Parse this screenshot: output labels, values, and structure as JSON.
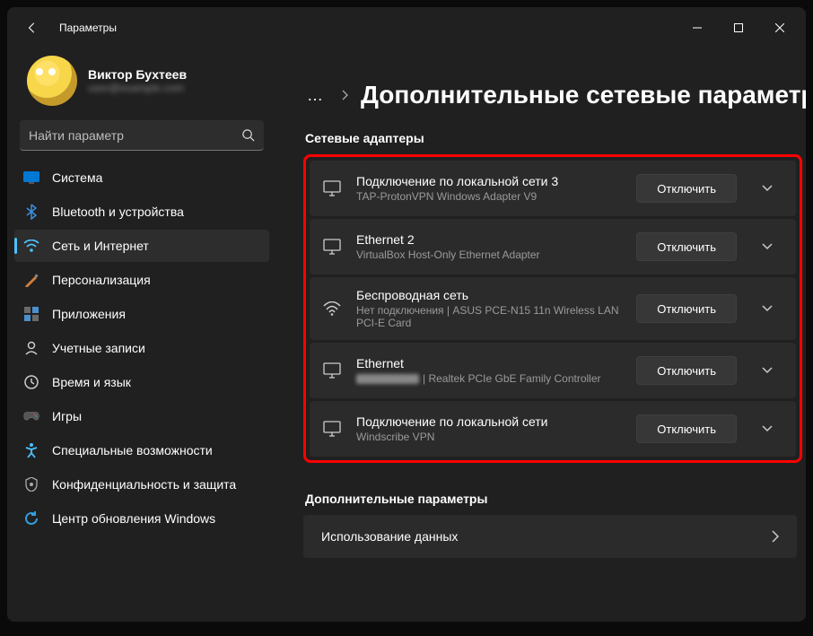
{
  "window": {
    "title": "Параметры"
  },
  "profile": {
    "name": "Виктор Бухтеев",
    "sub": "user@example.com"
  },
  "search": {
    "placeholder": "Найти параметр"
  },
  "nav": {
    "items": [
      {
        "label": "Система",
        "icon": "system"
      },
      {
        "label": "Bluetooth и устройства",
        "icon": "bluetooth"
      },
      {
        "label": "Сеть и Интернет",
        "icon": "network",
        "selected": true
      },
      {
        "label": "Персонализация",
        "icon": "personalization"
      },
      {
        "label": "Приложения",
        "icon": "apps"
      },
      {
        "label": "Учетные записи",
        "icon": "accounts"
      },
      {
        "label": "Время и язык",
        "icon": "time"
      },
      {
        "label": "Игры",
        "icon": "gaming"
      },
      {
        "label": "Специальные возможности",
        "icon": "accessibility"
      },
      {
        "label": "Конфиденциальность и защита",
        "icon": "privacy"
      },
      {
        "label": "Центр обновления Windows",
        "icon": "update"
      }
    ]
  },
  "page": {
    "title": "Дополнительные сетевые параметры",
    "breadcrumb_overflow": "…",
    "section_adapters": "Сетевые адаптеры",
    "section_more": "Дополнительные параметры",
    "data_usage": "Использование данных"
  },
  "adapters": [
    {
      "name": "Подключение по локальной сети 3",
      "sub": "TAP-ProtonVPN Windows Adapter V9",
      "icon": "monitor",
      "action": "Отключить"
    },
    {
      "name": "Ethernet 2",
      "sub": "VirtualBox Host-Only Ethernet Adapter",
      "icon": "monitor",
      "action": "Отключить"
    },
    {
      "name": "Беспроводная сеть",
      "sub": "Нет подключения | ASUS PCE-N15 11n Wireless LAN PCI-E Card",
      "icon": "wifi",
      "action": "Отключить"
    },
    {
      "name": "Ethernet",
      "sub": "| Realtek PCIe GbE Family Controller",
      "sub_blurred_prefix": true,
      "icon": "monitor",
      "action": "Отключить"
    },
    {
      "name": "Подключение по локальной сети",
      "sub": "Windscribe VPN",
      "icon": "monitor",
      "action": "Отключить"
    }
  ]
}
